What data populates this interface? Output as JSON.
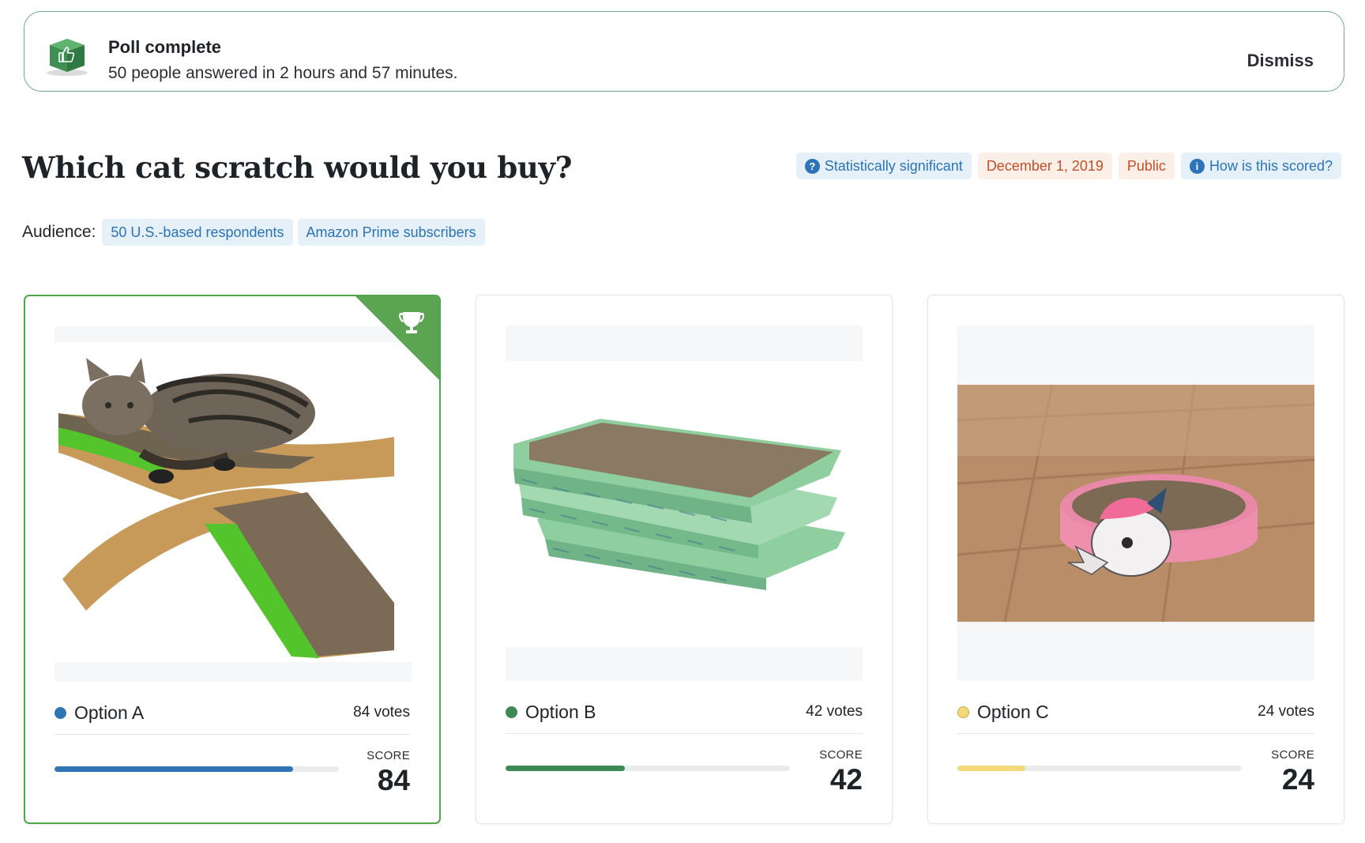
{
  "banner": {
    "title": "Poll complete",
    "subtitle": "50 people answered in 2 hours and 57 minutes.",
    "dismiss_label": "Dismiss"
  },
  "poll": {
    "question": "Which cat scratch would you buy?",
    "badges": [
      {
        "label": "Statistically significant",
        "icon": "question-circle-icon",
        "style": "blue"
      },
      {
        "label": "December 1, 2019",
        "style": "orange"
      },
      {
        "label": "Public",
        "style": "orange"
      },
      {
        "label": "How is this scored?",
        "icon": "info-circle-icon",
        "style": "blue"
      }
    ],
    "audience_label": "Audience:",
    "audience_tags": [
      "50 U.S.-based respondents",
      "Amazon Prime subscribers"
    ]
  },
  "options": [
    {
      "name": "Option A",
      "votes": "84 votes",
      "score_label": "SCORE",
      "score": "84",
      "score_value": 84,
      "color": "#2f74b5",
      "winner": true,
      "image": "cat-on-x-shaped-cardboard-scratcher"
    },
    {
      "name": "Option B",
      "votes": "42 votes",
      "score_label": "SCORE",
      "score": "42",
      "score_value": 42,
      "color": "#3d8a56",
      "winner": false,
      "image": "stack-of-flat-cardboard-scratchers"
    },
    {
      "name": "Option C",
      "votes": "24 votes",
      "score_label": "SCORE",
      "score": "24",
      "score_value": 24,
      "color": "#f3d97a",
      "winner": false,
      "image": "round-unicorn-scratcher-bowl"
    }
  ],
  "colors": {
    "accent_blue": "#2b74b8",
    "accent_orange": "#c4502a",
    "winner_green": "#4fa64d"
  }
}
